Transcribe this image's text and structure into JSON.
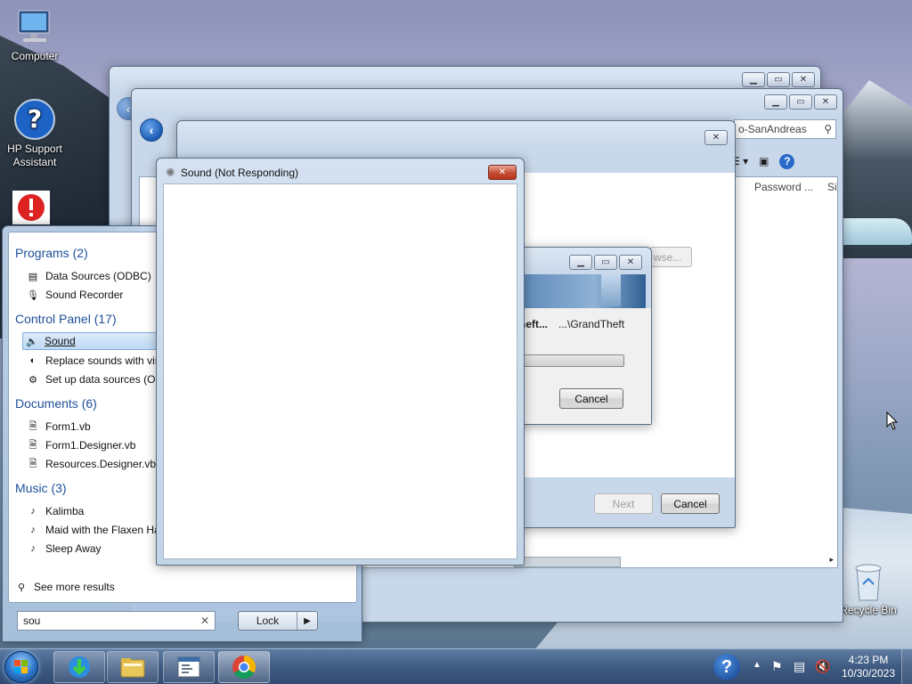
{
  "desktop": {
    "icons": [
      {
        "label": "Computer"
      },
      {
        "label": "HP Support Assistant"
      },
      {
        "label": "Recycle Bin"
      }
    ]
  },
  "explorer_back": {
    "address_tail": "o-SanAndreas",
    "column_password": "Password ...",
    "column_size": "Si"
  },
  "installer": {
    "browse_label": "wse...",
    "next_label": "Next",
    "cancel_label": "Cancel"
  },
  "copy_dialog": {
    "from_text": "heft...",
    "to_text": "...\\GrandTheft",
    "cancel_label": "Cancel"
  },
  "sound_window": {
    "title": "Sound (Not Responding)"
  },
  "start_menu": {
    "categories": [
      {
        "label": "Programs (2)",
        "items": [
          "Data Sources (ODBC)",
          "Sound Recorder"
        ]
      },
      {
        "label": "Control Panel (17)",
        "items": [
          "Sound",
          "Replace sounds with vis",
          "Set up data sources (OD"
        ]
      },
      {
        "label": "Documents (6)",
        "items": [
          "Form1.vb",
          "Form1.Designer.vb",
          "Resources.Designer.vb"
        ]
      },
      {
        "label": "Music (3)",
        "items": [
          "Kalimba",
          "Maid with the Flaxen Ha",
          "Sleep Away"
        ]
      }
    ],
    "see_more": "See more results",
    "search_value": "sou",
    "lock_label": "Lock"
  },
  "taskbar": {
    "time": "4:23 PM",
    "date": "10/30/2023"
  },
  "colors": {
    "accent": "#1e4f9a",
    "close_red": "#c44b33"
  }
}
